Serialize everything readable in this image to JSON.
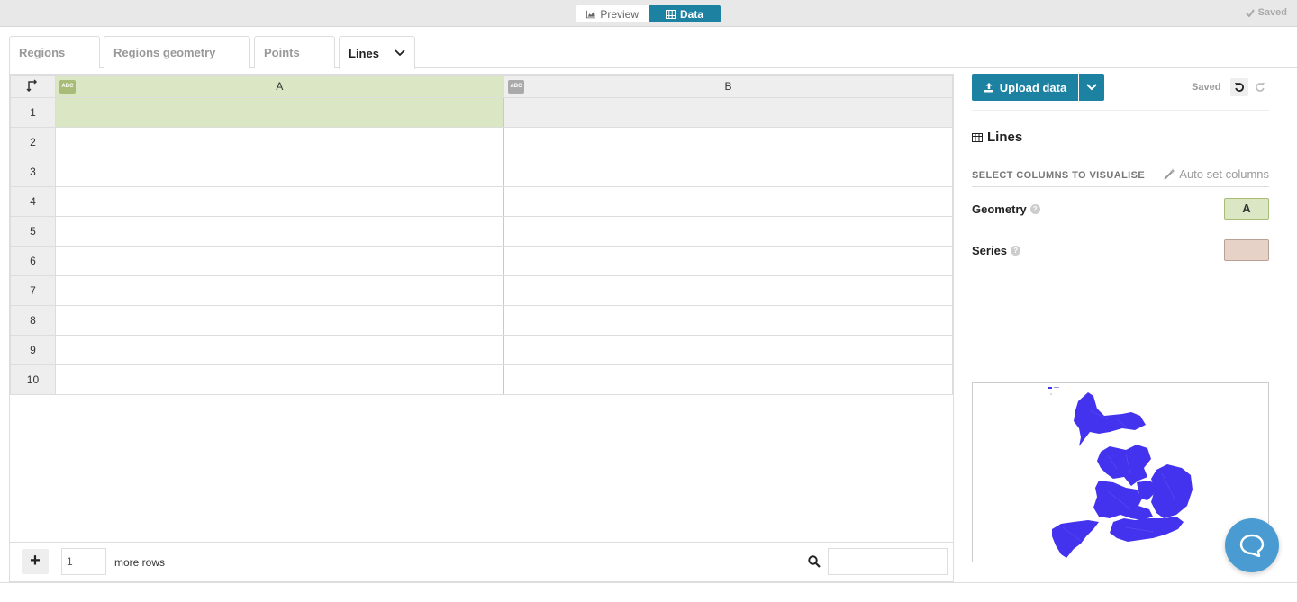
{
  "view_toggle": {
    "preview_label": "Preview",
    "data_label": "Data"
  },
  "top_saved": "Saved",
  "tabs": [
    {
      "label": "Regions"
    },
    {
      "label": "Regions geometry"
    },
    {
      "label": "Points"
    },
    {
      "label": "Lines"
    }
  ],
  "grid": {
    "columns": [
      "A",
      "B"
    ],
    "column_type_badge": "ABC",
    "rows": [
      "1",
      "2",
      "3",
      "4",
      "5",
      "6",
      "7",
      "8",
      "9",
      "10"
    ],
    "add_rows_count": "1",
    "more_rows_label": "more rows"
  },
  "sidebar": {
    "upload_label": "Upload data",
    "saved_label": "Saved",
    "sheet_title": "Lines",
    "select_columns_label": "SELECT COLUMNS TO VISUALISE",
    "auto_set_label": "Auto set columns",
    "bindings": [
      {
        "label": "Geometry",
        "value": "A",
        "color": "#dbe6c4"
      },
      {
        "label": "Series",
        "value": "",
        "color": "#e6d2c6"
      }
    ]
  },
  "colors": {
    "accent": "#1d81a2",
    "map_fill": "#4433ee",
    "column_a": "#dbe6c4",
    "chat": "#4a9bd1"
  }
}
